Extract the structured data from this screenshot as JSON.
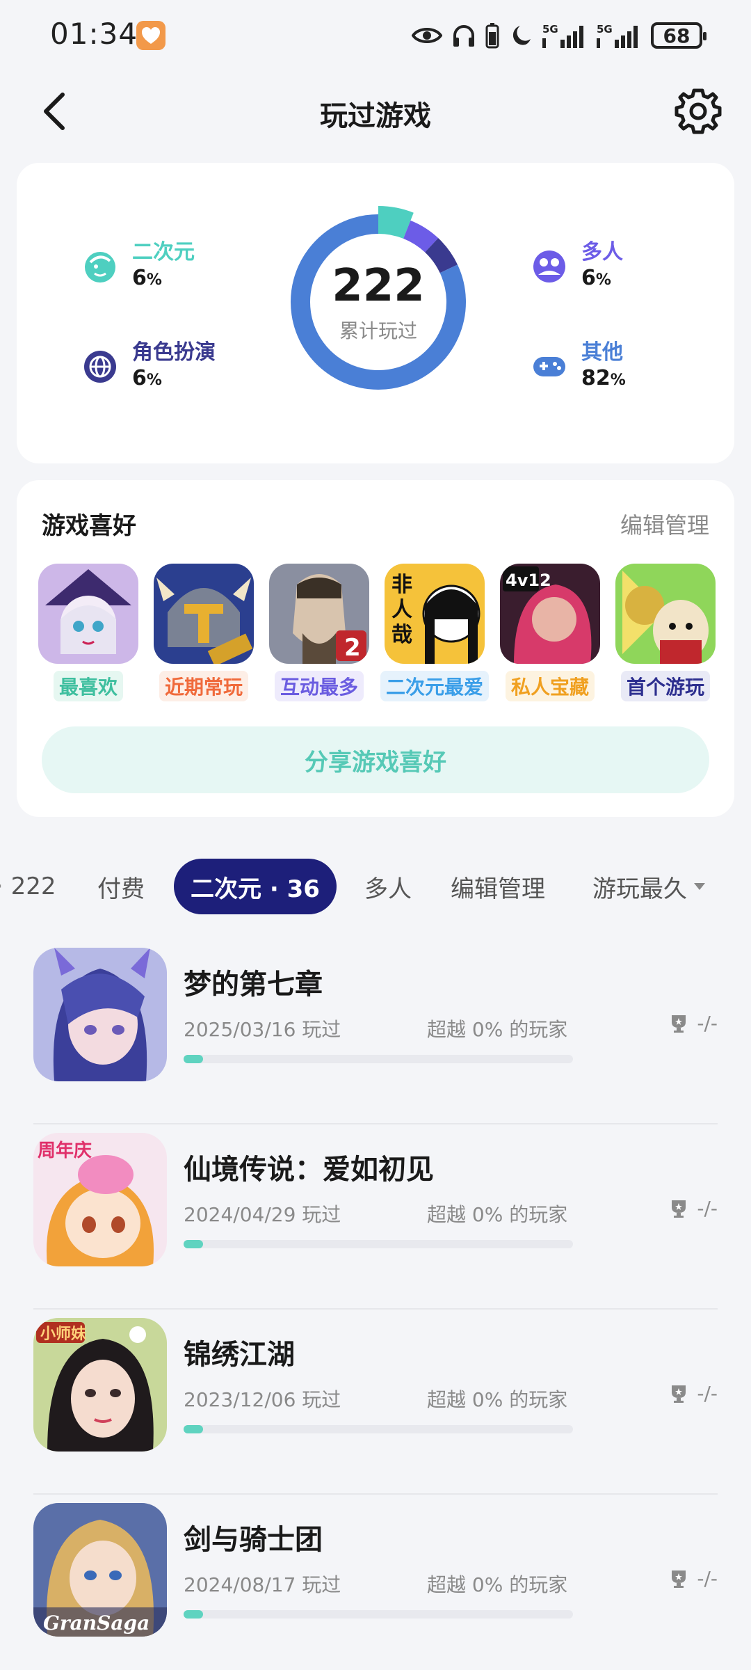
{
  "status_bar": {
    "time": "01:34",
    "battery": "68",
    "signal_labels": [
      "5G",
      "5G"
    ]
  },
  "header": {
    "title": "玩过游戏"
  },
  "stats": {
    "total": "222",
    "total_caption": "累计玩过",
    "categories": [
      {
        "label": "二次元",
        "percent": "6",
        "unit": "%",
        "color": "#4ecfc0",
        "icon": "face-icon"
      },
      {
        "label": "角色扮演",
        "percent": "6",
        "unit": "%",
        "color": "#3a3a8f",
        "icon": "globe-icon"
      },
      {
        "label": "多人",
        "percent": "6",
        "unit": "%",
        "color": "#6c5ce7",
        "icon": "people-icon"
      },
      {
        "label": "其他",
        "percent": "82",
        "unit": "%",
        "color": "#4a7fd6",
        "icon": "gamepad-icon"
      }
    ]
  },
  "preferences": {
    "title": "游戏喜好",
    "edit_label": "编辑管理",
    "items": [
      {
        "tag": "最喜欢",
        "tag_color": "#3fbf9f",
        "tag_bg": "#e6f7f1"
      },
      {
        "tag": "近期常玩",
        "tag_color": "#f06a3b",
        "tag_bg": "#fdeee6"
      },
      {
        "tag": "互动最多",
        "tag_color": "#6a5ce0",
        "tag_bg": "#eeebfc"
      },
      {
        "tag": "二次元最爱",
        "tag_color": "#3a9ee8",
        "tag_bg": "#e6f2fc"
      },
      {
        "tag": "私人宝藏",
        "tag_color": "#f0a020",
        "tag_bg": "#fdf3e0"
      },
      {
        "tag": "首个游玩",
        "tag_color": "#2d2f8f",
        "tag_bg": "#e9eaf6"
      }
    ],
    "share_label": "分享游戏喜好"
  },
  "tabs": {
    "all_count": "222",
    "paid": "付费",
    "active": "二次元 · 36",
    "multi": "多人",
    "edit": "编辑管理",
    "sort": "游玩最久"
  },
  "games": [
    {
      "name": "梦的第七章",
      "date": "2025/03/16 玩过",
      "rank": "超越 0% 的玩家",
      "trophy": "-/-",
      "progress": 0
    },
    {
      "name": "仙境传说：爱如初见",
      "date": "2024/04/29 玩过",
      "rank": "超越 0% 的玩家",
      "trophy": "-/-",
      "progress": 0
    },
    {
      "name": "锦绣江湖",
      "date": "2023/12/06 玩过",
      "rank": "超越 0% 的玩家",
      "trophy": "-/-",
      "progress": 0
    },
    {
      "name": "剑与骑士团",
      "date": "2024/08/17 玩过",
      "rank": "超越 0% 的玩家",
      "trophy": "-/-",
      "progress": 0
    }
  ]
}
